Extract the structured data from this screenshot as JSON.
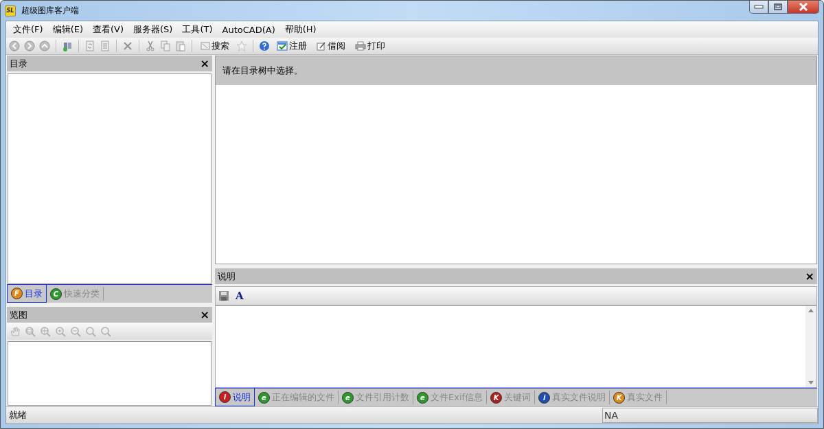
{
  "window": {
    "title": "超级图库客户端",
    "app_icon": "SL"
  },
  "menu": [
    "文件(F)",
    "编辑(E)",
    "查看(V)",
    "服务器(S)",
    "工具(T)",
    "AutoCAD(A)",
    "帮助(H)"
  ],
  "toolbar": {
    "search": "搜索",
    "register": "注册",
    "borrow": "借阅",
    "print": "打印"
  },
  "catalog_panel": {
    "title": "目录",
    "close": "×",
    "tabs": [
      {
        "label": "目录",
        "badge": "F",
        "color": "#e08a1a",
        "selected": true
      },
      {
        "label": "快速分类",
        "badge": "C",
        "color": "#2e9a2e",
        "selected": false
      }
    ]
  },
  "overview_panel": {
    "title": "览图",
    "close": "×"
  },
  "content": {
    "message": "请在目录树中选择。"
  },
  "description_panel": {
    "title": "说明",
    "close": "×",
    "font_button": "A",
    "tabs": [
      {
        "label": "说明",
        "badge": "i",
        "color": "#c81e1e",
        "selected": true
      },
      {
        "label": "正在编辑的文件",
        "badge": "e",
        "color": "#2e9a2e",
        "selected": false
      },
      {
        "label": "文件引用计数",
        "badge": "e",
        "color": "#2e9a2e",
        "selected": false
      },
      {
        "label": "文件Exif信息",
        "badge": "e",
        "color": "#2e9a2e",
        "selected": false
      },
      {
        "label": "关键词",
        "badge": "K",
        "color": "#b01e1e",
        "selected": false
      },
      {
        "label": "真实文件说明",
        "badge": "i",
        "color": "#1e4fb0",
        "selected": false
      },
      {
        "label": "真实文件",
        "badge": "K",
        "color": "#e08a1a",
        "selected": false
      }
    ]
  },
  "status_bar": {
    "text": "就绪",
    "field": "NA"
  }
}
